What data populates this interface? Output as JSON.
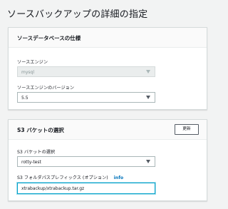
{
  "page": {
    "title": "ソースバックアップの詳細の指定"
  },
  "source_db_panel": {
    "header": "ソースデータベースの仕様",
    "engine": {
      "label": "ソースエンジン",
      "value": "mysql",
      "disabled": true
    },
    "engine_version": {
      "label": "ソースエンジンのバージョン",
      "value": "5.5"
    }
  },
  "s3_panel": {
    "header": "S3 バケットの選択",
    "refresh_label": "更新",
    "bucket": {
      "label": "S3 バケットの選択",
      "value": "rotty-test"
    },
    "prefix": {
      "label": "S3 フォルダパスプレフィックス (オプション)",
      "info_link": "info",
      "value": "xtrabackup/xtrabackup.tar.gz"
    }
  },
  "colors": {
    "background": "#f2f3f3",
    "panel": "#ffffff",
    "link": "#0073bb",
    "focus_border": "#00a1c9"
  }
}
